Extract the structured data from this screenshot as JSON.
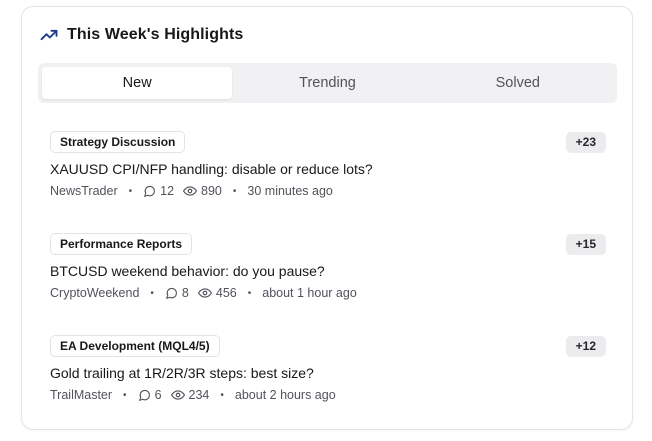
{
  "widget": {
    "title": "This Week's Highlights",
    "icon": "trending-up-icon",
    "accent_color": "#1e3a8a"
  },
  "tabs": [
    {
      "label": "New",
      "active": true
    },
    {
      "label": "Trending",
      "active": false
    },
    {
      "label": "Solved",
      "active": false
    }
  ],
  "posts": [
    {
      "category": "Strategy Discussion",
      "score": "+23",
      "title": "XAUUSD CPI/NFP handling: disable or reduce lots?",
      "author": "NewsTrader",
      "comments": "12",
      "views": "890",
      "time": "30 minutes ago"
    },
    {
      "category": "Performance Reports",
      "score": "+15",
      "title": "BTCUSD weekend behavior: do you pause?",
      "author": "CryptoWeekend",
      "comments": "8",
      "views": "456",
      "time": "about 1 hour ago"
    },
    {
      "category": "EA Development (MQL4/5)",
      "score": "+12",
      "title": "Gold trailing at 1R/2R/3R steps: best size?",
      "author": "TrailMaster",
      "comments": "6",
      "views": "234",
      "time": "about 2 hours ago"
    }
  ],
  "separator": "•"
}
